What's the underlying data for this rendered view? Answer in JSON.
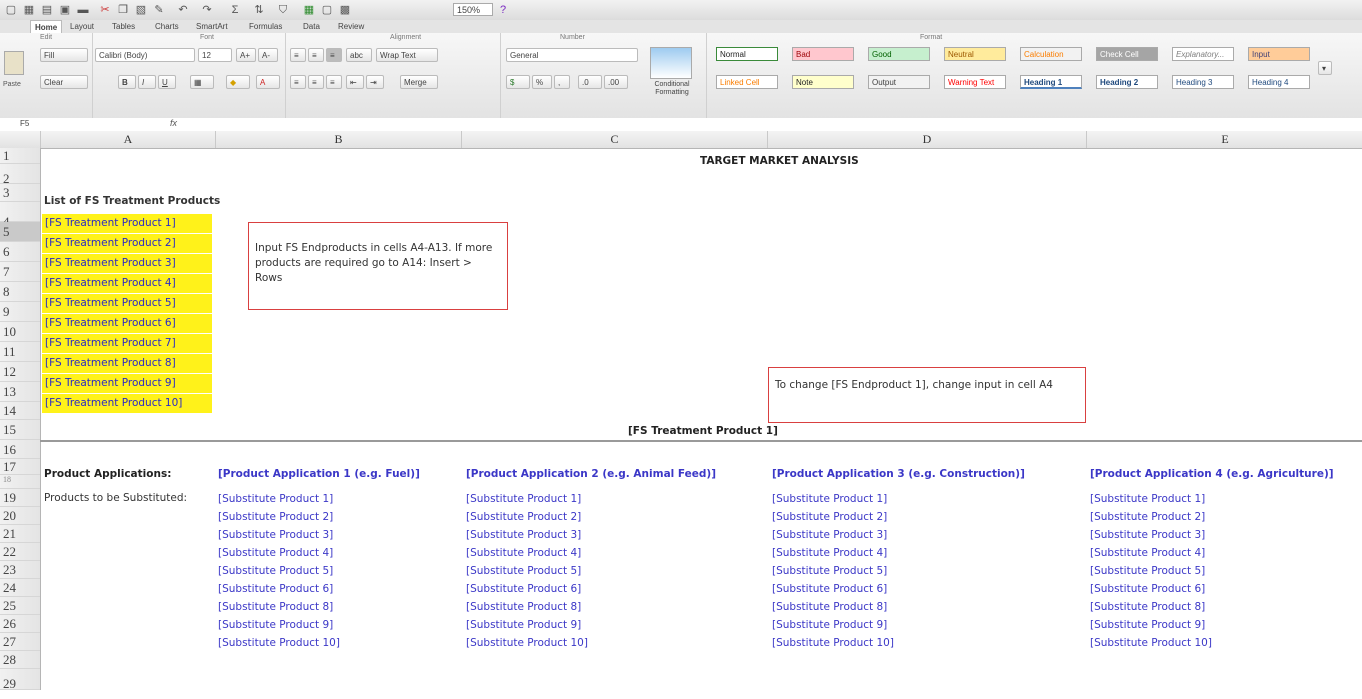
{
  "toolbar": {
    "zoom": "150%"
  },
  "ribbon": {
    "tabs": [
      "Home",
      "Layout",
      "Tables",
      "Charts",
      "SmartArt",
      "Formulas",
      "Data",
      "Review"
    ],
    "groups": [
      "Edit",
      "Font",
      "Alignment",
      "Number",
      "Format"
    ],
    "paste": "Paste",
    "fill": "Fill",
    "clear": "Clear",
    "font_name": "Calibri (Body)",
    "font_size": "12",
    "wrap_text": "Wrap Text",
    "number_format": "General",
    "merge": "Merge",
    "conditional_formatting": "Conditional Formatting",
    "styles": [
      "Normal",
      "Bad",
      "Good",
      "Neutral",
      "Calculation",
      "Check Cell",
      "Explanatory...",
      "Input",
      "Linked Cell",
      "Note",
      "Output",
      "Warning Text",
      "Heading 1",
      "Heading 2",
      "Heading 3",
      "Heading 4"
    ],
    "style_colors": [
      "#ffffff",
      "#ffc7ce",
      "#c6efce",
      "#ffeb9c",
      "#f2f2f2",
      "#a5a5a5",
      "#ffffff",
      "#ffcc99",
      "#ffffff",
      "#ffffcc",
      "#f2f2f2",
      "#ffffff",
      "#ffffff",
      "#ffffff",
      "#ffffff",
      "#ffffff"
    ]
  },
  "formula_bar": {
    "cell_ref": "F5",
    "fx": "fx"
  },
  "columns": [
    "A",
    "B",
    "C",
    "D",
    "E"
  ],
  "rows": [
    "1",
    "2",
    "3",
    "4",
    "5",
    "6",
    "7",
    "8",
    "9",
    "10",
    "11",
    "12",
    "13",
    "14",
    "15",
    "16",
    "17",
    "18",
    "19",
    "20",
    "21",
    "22",
    "23",
    "24",
    "25",
    "26",
    "27",
    "28",
    "29"
  ],
  "sheet": {
    "title": "TARGET MARKET ANALYSIS",
    "list_header": "List of FS Treatment Products",
    "products": [
      "[FS Treatment Product 1]",
      "[FS Treatment Product 2]",
      "[FS Treatment Product 3]",
      "[FS Treatment Product 4]",
      "[FS Treatment Product 5]",
      "[FS Treatment Product 6]",
      "[FS Treatment Product 7]",
      "[FS Treatment Product 8]",
      "[FS Treatment Product 9]",
      "[FS Treatment Product 10]"
    ],
    "note1": "Input FS Endproducts in cells A4-A13. If more products are required go to A14: Insert > Rows",
    "note2": "To change [FS Endproduct 1], change input in cell A4",
    "section_title": "[FS Treatment Product 1]",
    "product_applications_label": "Product Applications:",
    "substituted_label": "Products to be Substituted:",
    "applications": [
      "[Product Application 1 (e.g. Fuel)]",
      "[Product Application 2 (e.g. Animal Feed)]",
      "[Product Application 3 (e.g. Construction)]",
      "[Product Application 4 (e.g. Agriculture)]"
    ],
    "substitutes": [
      "[Substitute Product 1]",
      "[Substitute Product 2]",
      "[Substitute Product 3]",
      "[Substitute Product 4]",
      "[Substitute Product 5]",
      "[Substitute Product 6]",
      "[Substitute Product 8]",
      "[Substitute Product 9]",
      "[Substitute Product 10]"
    ]
  }
}
